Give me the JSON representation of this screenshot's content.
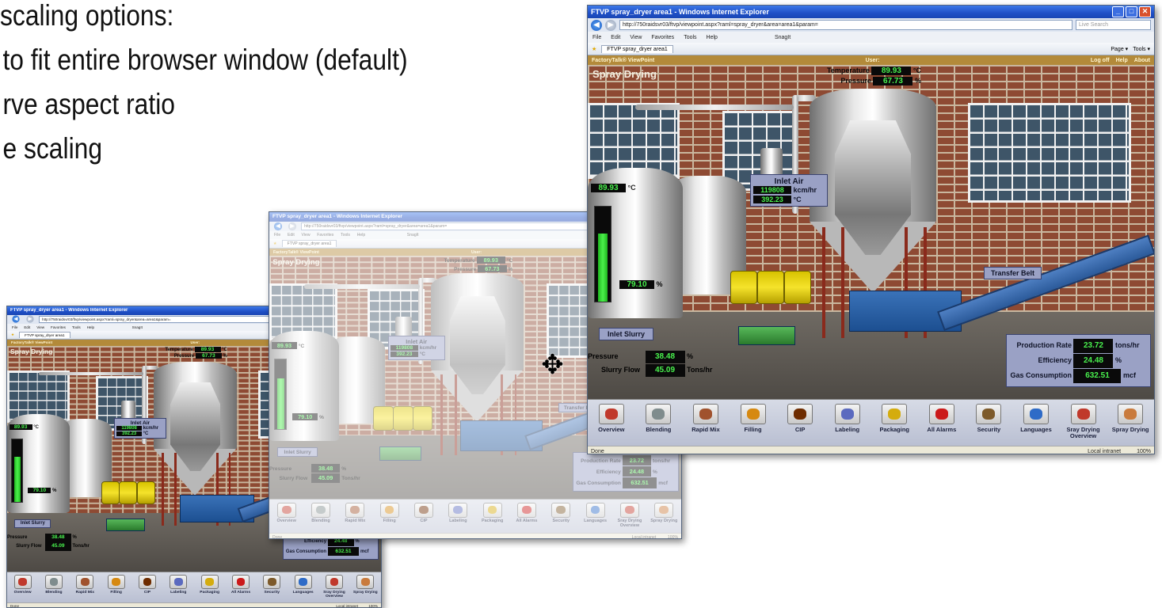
{
  "bullets": [
    "scaling options:",
    "to fit entire browser window (default)",
    "rve aspect ratio",
    "e scaling"
  ],
  "browser": {
    "title": "FTVP spray_dryer area1 - Windows Internet Explorer",
    "url": "http://750raidsvr03/ftvp/viewpoint.aspx?raml=spray_dryer&area=area1&param=",
    "search_placeholder": "Live Search",
    "menu": [
      "File",
      "Edit",
      "View",
      "Favorites",
      "Tools",
      "Help"
    ],
    "snagit_label": "SnagIt",
    "tab_label": "FTVP spray_dryer area1",
    "tools_items": [
      "Page ▾",
      "Tools ▾"
    ]
  },
  "viewpoint": {
    "brand": "FactoryTalk® ViewPoint",
    "user_label": "User:",
    "links": [
      "Log off",
      "Help",
      "About"
    ]
  },
  "scene": {
    "title": "Spray Drying",
    "temperature_label": "Temperature",
    "temperature_value": "89.93",
    "temperature_unit": "°C",
    "pressure_label": "Pressure",
    "pressure_value": "67.73",
    "pressure_unit": "%",
    "inlet_air_title": "Inlet Air",
    "inlet_air_flow": "119808",
    "inlet_air_flow_unit": "kcm/hr",
    "inlet_air_temp": "392.23",
    "inlet_air_temp_unit": "°C",
    "tank_temp": "89.93",
    "tank_temp_unit": "°C",
    "level_value": "79.10",
    "level_unit": "%",
    "level_fraction": 0.72,
    "inlet_slurry_title": "Inlet Slurry",
    "slurry_pressure_label": "Pressure",
    "slurry_pressure_value": "38.48",
    "slurry_pressure_unit": "%",
    "slurry_flow_label": "Slurry Flow",
    "slurry_flow_value": "45.09",
    "slurry_flow_unit": "Tons/hr",
    "transfer_belt": "Transfer Belt",
    "production_rate_label": "Production Rate",
    "production_rate_value": "23.72",
    "production_rate_unit": "tons/hr",
    "efficiency_label": "Efficiency",
    "efficiency_value": "24.48",
    "efficiency_unit": "%",
    "gas_label": "Gas Consumption",
    "gas_value": "632.51",
    "gas_unit": "mcf"
  },
  "toolbar": [
    {
      "label": "Overview",
      "icon": "overview-icon",
      "color": "#c0392b"
    },
    {
      "label": "Blending",
      "icon": "blending-icon",
      "color": "#7f8c8d"
    },
    {
      "label": "Rapid Mix",
      "icon": "rapid-mix-icon",
      "color": "#a0522d"
    },
    {
      "label": "Filling",
      "icon": "filling-icon",
      "color": "#d68910"
    },
    {
      "label": "CIP",
      "icon": "cip-icon",
      "color": "#6e2c00"
    },
    {
      "label": "Labeling",
      "icon": "labeling-icon",
      "color": "#5b6abf"
    },
    {
      "label": "Packaging",
      "icon": "packaging-icon",
      "color": "#d4ac0d"
    },
    {
      "label": "All Alarms",
      "icon": "alarm-icon",
      "color": "#cb1a1a"
    },
    {
      "label": "Security",
      "icon": "security-icon",
      "color": "#7d5a2a"
    },
    {
      "label": "Languages",
      "icon": "languages-icon",
      "color": "#2e6bc7"
    },
    {
      "label": "Sray Drying Overview",
      "icon": "spray-overview-icon",
      "color": "#c0392b"
    },
    {
      "label": "Spray Drying",
      "icon": "spray-drying-icon",
      "color": "#c97b3d"
    }
  ],
  "status": {
    "left": "Done",
    "zone": "Local intranet",
    "zoom": "100%"
  }
}
